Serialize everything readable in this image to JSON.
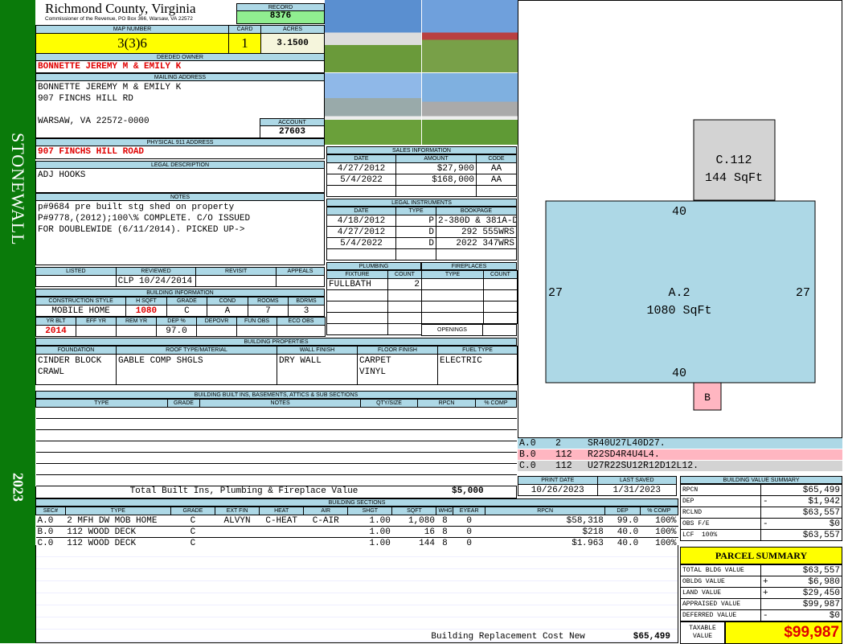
{
  "side": {
    "district": "STONEWALL",
    "year": "2023"
  },
  "header": {
    "county": "Richmond County, Virginia",
    "office": "Commissioner of the Revenue, PO Box 366, Warsaw, VA 22572",
    "record_label": "RECORD",
    "record": "8376"
  },
  "parcel": {
    "map_label": "MAP NUMBER",
    "map": "3(3)6",
    "card_label": "CARD",
    "card": "1",
    "acres_label": "ACRES",
    "acres": "3.1500"
  },
  "owner": {
    "label": "DEEDED OWNER",
    "value": "BONNETTE JEREMY M & EMILY K"
  },
  "mailing": {
    "label": "MAILING ADDRESS",
    "value": "BONNETTE JEREMY M & EMILY K\n907 FINCHS HILL RD\n\nWARSAW, VA 22572-0000",
    "account_label": "ACCOUNT",
    "account": "27603"
  },
  "physical": {
    "label": "PHYSICAL 911 ADDRESS",
    "value": "907 FINCHS HILL ROAD"
  },
  "legal": {
    "label": "LEGAL DESCRIPTION",
    "value": "ADJ HOOKS"
  },
  "notes": {
    "label": "NOTES",
    "value": "p#9684 pre built stg shed on property\nP#9778,(2012);100\\% COMPLETE. C/O ISSUED\nFOR DOUBLEWIDE (6/11/2014). PICKED UP->"
  },
  "review": {
    "headers": [
      "LISTED",
      "REVIEWED",
      "REVISIT",
      "APPEALS"
    ],
    "values": [
      "",
      "CLP 10/24/2014",
      "",
      ""
    ]
  },
  "building_info": {
    "label": "BUILDING INFORMATION",
    "h1": [
      "CONSTRUCTION STYLE",
      "H SQFT",
      "GRADE",
      "COND",
      "ROOMS",
      "BDRMS"
    ],
    "v1": [
      "MOBILE HOME",
      "1080",
      "C",
      "A",
      "7",
      "3"
    ],
    "h2": [
      "YR BLT",
      "EFF YR",
      "REM YR",
      "DEP %",
      "DEPOVR",
      "FUN OBS",
      "ECO OBS"
    ],
    "v2": [
      "2014",
      "",
      "",
      "97.0",
      "",
      "",
      ""
    ]
  },
  "sales": {
    "label": "SALES INFORMATION",
    "headers": [
      "DATE",
      "AMOUNT",
      "CODE"
    ],
    "rows": [
      [
        "4/27/2012",
        "$27,900",
        "AA"
      ],
      [
        "5/4/2022",
        "$168,000",
        "AA"
      ]
    ]
  },
  "instruments": {
    "label": "LEGAL INSTRUMENTS",
    "headers": [
      "DATE",
      "TYPE",
      "BOOKPAGE"
    ],
    "rows": [
      [
        "4/18/2012",
        "P",
        "2-380D & 381A-D"
      ],
      [
        "4/27/2012",
        "D",
        "292 555WRS"
      ],
      [
        "5/4/2022",
        "D",
        "2022 347WRS"
      ]
    ]
  },
  "plumbing": {
    "label": "PLUMBING",
    "headers": [
      "FIXTURE",
      "COUNT"
    ],
    "rows": [
      [
        "FULLBATH",
        "2"
      ]
    ]
  },
  "fireplaces": {
    "label": "FIREPLACES",
    "headers": [
      "TYPE",
      "COUNT"
    ],
    "openings_label": "OPENINGS"
  },
  "properties": {
    "label": "BUILDING PROPERTIES",
    "headers": [
      "FOUNDATION",
      "ROOF TYPE/MATERIAL",
      "WALL FINISH",
      "FLOOR FINISH",
      "FUEL TYPE"
    ],
    "values": [
      "CINDER BLOCK\nCRAWL",
      "GABLE          COMP SHGLS",
      "DRY WALL",
      "CARPET\nVINYL",
      "ELECTRIC"
    ]
  },
  "builtins": {
    "label": "BUILDING BUILT INS, BASEMENTS, ATTICS & SUB SECTIONS",
    "headers": [
      "TYPE",
      "GRADE",
      "NOTES",
      "QTY/SIZE",
      "RPCN",
      "% COMP"
    ],
    "total_label": "Total Built Ins, Plumbing & Fireplace Value",
    "total": "$5,000"
  },
  "sections": {
    "label": "BUILDING SECTIONS",
    "headers": [
      "SEC#",
      "TYPE",
      "GRADE",
      "EXT FIN",
      "HEAT",
      "AIR",
      "SHGT",
      "SQFT",
      "WHGT",
      "EYEAR",
      "RPCN",
      "DEP",
      "% COMP"
    ],
    "rows": [
      [
        "A.0",
        "2 MFH DW MOB HOME",
        "C",
        "ALVYN",
        "C-HEAT",
        "C-AIR",
        "1.00",
        "1,080",
        "8",
        "0",
        "$58,318",
        "99.0",
        "100%"
      ],
      [
        "B.0",
        "112 WOOD DECK",
        "C",
        "",
        "",
        "",
        "1.00",
        "16",
        "8",
        "0",
        "$218",
        "40.0",
        "100%"
      ],
      [
        "C.0",
        "112 WOOD DECK",
        "C",
        "",
        "",
        "",
        "1.00",
        "144",
        "8",
        "0",
        "$1,963",
        "40.0",
        "100%"
      ]
    ],
    "replacement_label": "Building Replacement Cost New",
    "replacement": "$65,499"
  },
  "sketch": {
    "areas": [
      {
        "name": "A.2",
        "sqft": "1080 SqFt",
        "top": "40",
        "bottom": "40",
        "left": "27",
        "right": "27"
      },
      {
        "name": "C.112",
        "sqft": "144 SqFt"
      },
      {
        "name": "B"
      }
    ],
    "codes": [
      {
        "sec": "A.0",
        "code": "2",
        "path": "SR40U27L40D27.",
        "color": "#add8e6"
      },
      {
        "sec": "B.0",
        "code": "112",
        "path": "R22SD4R4U4L4.",
        "color": "#ffb6c1"
      },
      {
        "sec": "C.0",
        "code": "112",
        "path": "U27R22SU12R12D12L12.",
        "color": "#d3d3d3"
      }
    ]
  },
  "dates": {
    "print_label": "PRINT DATE",
    "print": "10/26/2023",
    "saved_label": "LAST SAVED",
    "saved": "1/31/2023"
  },
  "value_summary": {
    "label": "BUILDING VALUE SUMMARY",
    "rows": [
      [
        "RPCN",
        "",
        "$65,499"
      ],
      [
        "DEP",
        "-",
        "$1,942"
      ],
      [
        "RCLND",
        "",
        "$63,557"
      ],
      [
        "OBS F/E",
        "-",
        "$0"
      ],
      [
        "LCF  100%",
        "",
        "$63,557"
      ]
    ]
  },
  "parcel_summary": {
    "label": "PARCEL SUMMARY",
    "rows": [
      [
        "TOTAL BLDG VALUE",
        "",
        "$63,557"
      ],
      [
        "OBLDG VALUE",
        "+",
        "$6,980"
      ],
      [
        "LAND VALUE",
        "+",
        "$29,450"
      ],
      [
        "APPRAISED VALUE",
        "",
        "$99,987"
      ],
      [
        "DEFERRED VALUE",
        "-",
        "$0"
      ]
    ],
    "taxable_label": "TAXABLE VALUE",
    "taxable": "$99,987"
  }
}
